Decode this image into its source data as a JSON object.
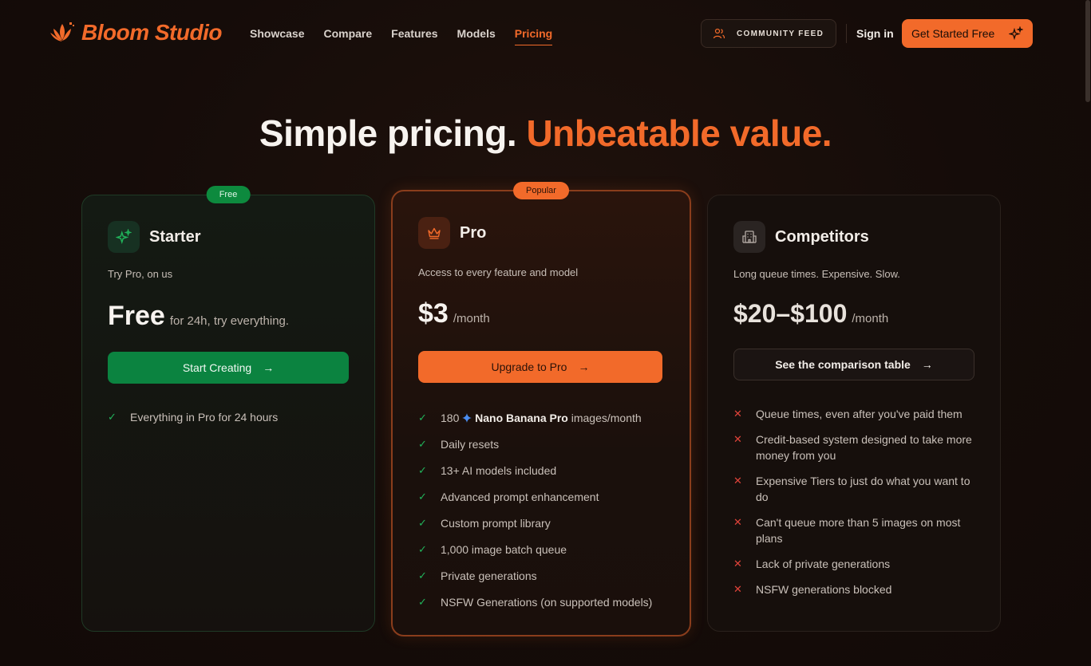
{
  "nav": {
    "brand": "Bloom Studio",
    "links": [
      "Showcase",
      "Compare",
      "Features",
      "Models",
      "Pricing"
    ],
    "community_label": "COMMUNITY FEED",
    "signin_label": "Sign in",
    "cta_label": "Get Started Free"
  },
  "hero": {
    "title_main": "Simple pricing.",
    "title_accent": "Unbeatable value."
  },
  "plans": {
    "starter": {
      "badge": "Free",
      "name": "Starter",
      "subtitle": "Try Pro, on us",
      "price": "Free",
      "price_note": "for 24h, try everything.",
      "button": "Start Creating",
      "features": [
        "Everything in Pro for 24 hours"
      ]
    },
    "pro": {
      "badge": "Popular",
      "name": "Pro",
      "subtitle": "Access to every feature and model",
      "price": "$3",
      "price_note": "/month",
      "button": "Upgrade to Pro",
      "feature_first_prefix": "180",
      "feature_first_bold": "Nano Banana Pro",
      "feature_first_suffix": "images/month",
      "features": [
        "Daily resets",
        "13+ AI models included",
        "Advanced prompt enhancement",
        "Custom prompt library",
        "1,000 image batch queue",
        "Private generations",
        "NSFW Generations (on supported models)"
      ]
    },
    "competitors": {
      "name": "Competitors",
      "subtitle": "Long queue times. Expensive. Slow.",
      "price": "$20–$100",
      "price_note": "/month",
      "button": "See the comparison table",
      "features": [
        "Queue times, even after you've paid them",
        "Credit-based system designed to take more money from you",
        "Expensive Tiers to just do what you want to do",
        "Can't queue more than 5 images on most plans",
        "Lack of private generations",
        "NSFW generations blocked"
      ]
    }
  },
  "colors": {
    "accent": "#f26a2a",
    "green": "#0b8340",
    "background": "#140b08"
  }
}
